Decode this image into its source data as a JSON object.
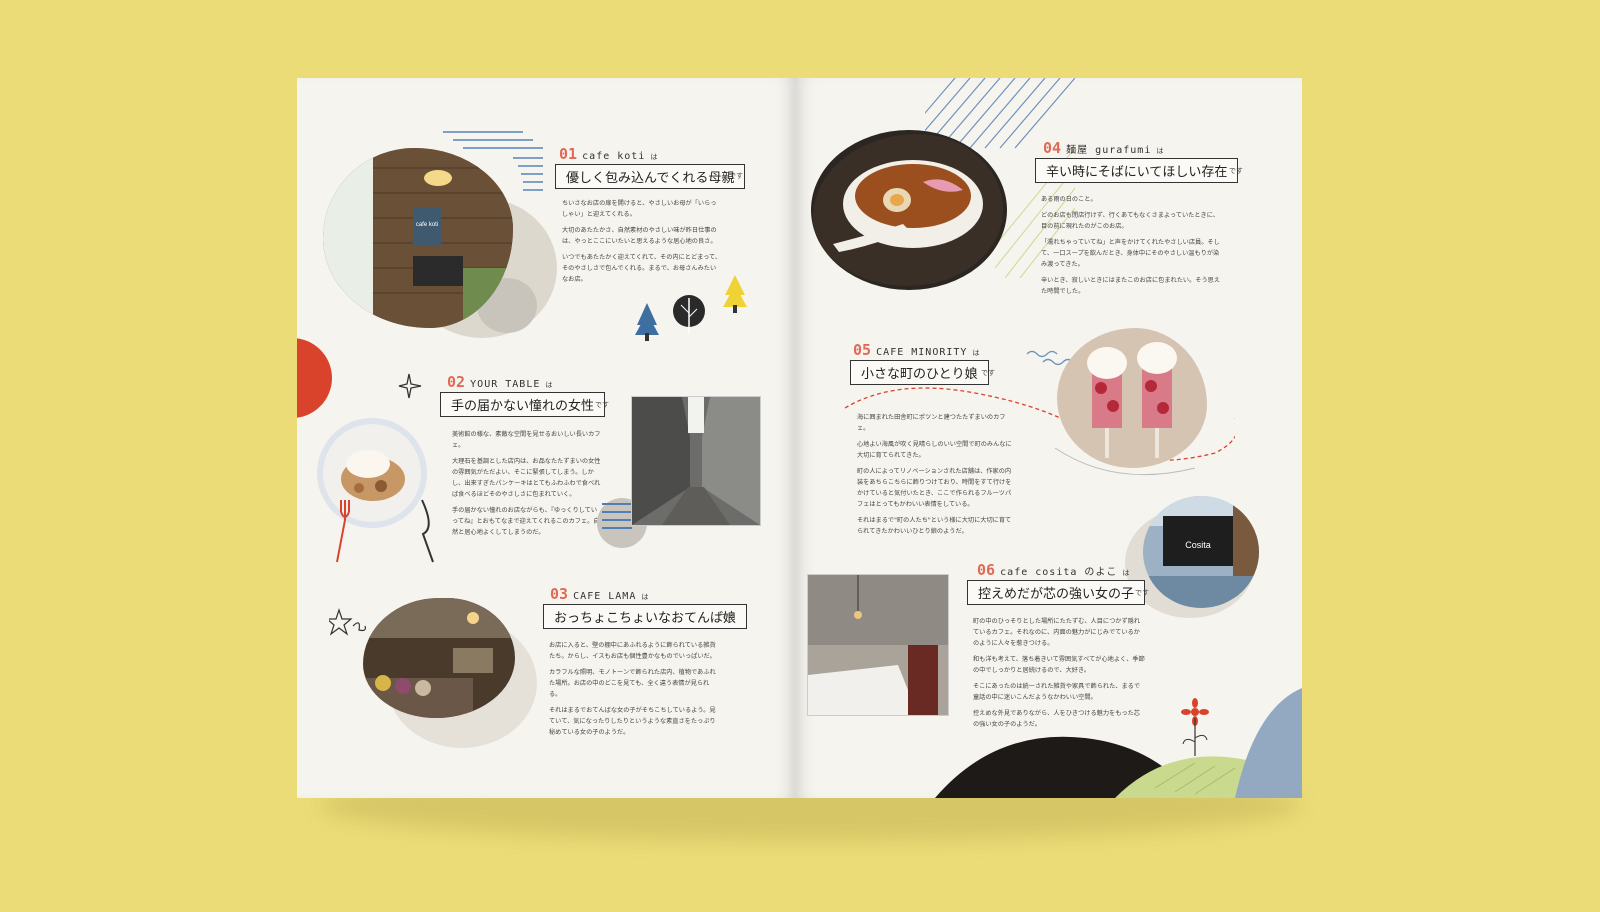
{
  "colors": {
    "background": "#ebdc77",
    "paper": "#f6f4ef",
    "accent_red": "#e06a55",
    "accent_blue": "#6f93bd",
    "ink": "#222222"
  },
  "articles": [
    {
      "num": "01",
      "name": "cafe koti",
      "particle": "は",
      "tagline": "優しく包み込んでくれる母親",
      "desu": "です",
      "body": [
        "ちいさなお店の扉を開けると、やさしいお母が「いらっしゃい」と迎えてくれる。",
        "大切のあたたかさ、自然素材のやさしい味が昨日仕事のは、やっとここにいたいと思えるような居心地の良さ。",
        "いつでもあたたかく迎えてくれて、その内にとどまって、そのやさしさで包んでくれる。まるで、お母さんみたいなお店。"
      ],
      "sign": "cafe koti"
    },
    {
      "num": "02",
      "name": "YOUR TABLE",
      "particle": "は",
      "tagline": "手の届かない憧れの女性",
      "desu": "です",
      "body": [
        "美術館の様な、素敵な空間を見せるおいしい長いカフェ。",
        "大理石を基調とした店内は、お品なたたずまいの女性の雰囲気がただよい、そこに緊張してしまう。しかし、出来すぎたパンケーキはとてもふわふわで食べれば食べるほどそのやさしさに包まれていく。",
        "手の届かない憧れのお店ながらも、『ゆっくりしていってね』とおもてなまで迎えてくれるこのカフェ。自然と居心地よくしてしまうのだ。"
      ]
    },
    {
      "num": "03",
      "name": "CAFE LAMA",
      "particle": "は",
      "tagline": "おっちょこちょいなおてんば娘",
      "desu": "です",
      "body": [
        "お店に入ると、壁の棚中にあふれるように飾られている雑貨たち。からし、イスもお店も個性豊かなものでいっぱいだ。",
        "カラフルな照明、モノトーンで飾られた店内、植物であふれた場所。お店の中のどこを見ても、全く違う表情が見られる。",
        "それはまるでおてんばな女の子がそちこちしているよう。見ていて、気になったりしたりというような素直さをたっぷり秘めている女の子のようだ。"
      ]
    },
    {
      "num": "04",
      "name": "麺屋 gurafumi",
      "particle": "は",
      "tagline": "辛い時にそばにいてほしい存在",
      "desu": "です",
      "body": [
        "ある雨の日のこと。",
        "どのお店も閉店行けず、行くあてもなくさまよっていたときに、目の前に現れたのがこのお店。",
        "「濡れちゃっていてね」と声をかけてくれたやさしい店員。そして、一口スープを飲んだとき、身体中にそのやさしい温もりが染み渡ってきた。",
        "辛いとき、寂しいときにはまたこのお店に包まれたい。そう思えた時間でした。"
      ]
    },
    {
      "num": "05",
      "name": "CAFE MINORITY",
      "particle": "は",
      "tagline": "小さな町のひとり娘",
      "desu": "です",
      "body": [
        "海に囲まれた田舎町にポツンと建つたたずまいのカフェ。",
        "心地よい海風が吹く見晴らしのいい空間で町のみんなに大切に育てられてきた。",
        "町の人によってリノベーションされた店舗は、作家の内装をあちらこちらに飾りつけており、時間をすて行けをかけていると気付いたとき、ここで作られるフルーツパフェはとってもかわいい表情をしている。",
        "それはまるで\"町の人たち\"という様に大切に大切に育てられてきたかわいいひとり娘のようだ。"
      ]
    },
    {
      "num": "06",
      "name": "cafe cosita のよこ",
      "particle": "は",
      "tagline": "控えめだが芯の強い女の子",
      "desu": "です",
      "body": [
        "町の中のひっそりとした場所にたたずむ、人目につかず隠れているカフェ。それなのに、内面の魅力がにじみでているかのように人々を惹きつける。",
        "和も洋も考えて、落ち着きいて雰囲気すべてが心地よく、季節の中でしっかりと居続けるので、大好き。",
        "そこにあったのは統一された雑貨や家具で飾られた、まるで童話の中に迷いこんだようなかわいい空間。",
        "控えめな外見でありながら、人をひきつける魅力をもった芯の強い女の子のようだ。"
      ],
      "sign": "Cosita"
    }
  ]
}
